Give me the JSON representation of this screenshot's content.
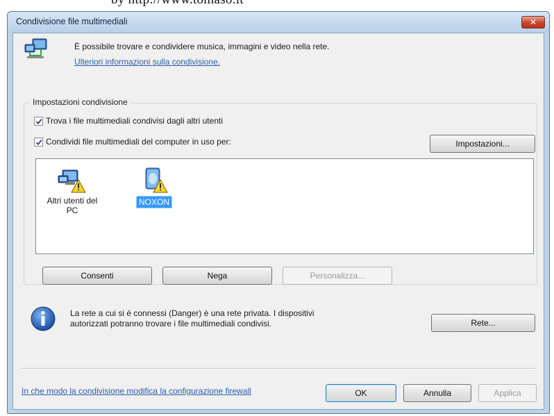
{
  "page_top_text": "by http://www.tomaso.it",
  "window": {
    "title": "Condivisione file multimediali",
    "close_label": "✕"
  },
  "header": {
    "description": "È possibile trovare e condividere musica, immagini e video nella rete.",
    "more_info_link": "Ulteriori informazioni sulla condivisione."
  },
  "sharing_settings": {
    "group_label": "Impostazioni condivisione",
    "find_shared_label": "Trova i file multimediali condivisi dagli altri utenti",
    "find_shared_checked": true,
    "share_media_label": "Condividi file multimediali del computer in uso per:",
    "share_media_checked": true,
    "settings_button": "Impostazioni...",
    "devices": [
      {
        "label": "Altri utenti del PC",
        "selected": false,
        "icon": "pc-users-warning-icon"
      },
      {
        "label": "NOXON",
        "selected": true,
        "icon": "media-device-warning-icon"
      }
    ],
    "allow_button": "Consenti",
    "deny_button": "Nega",
    "customize_button": "Personalizza..."
  },
  "network_info": {
    "text_line1": "La rete a cui si è connessi (Danger) è una rete privata. I dispositivi",
    "text_line2": "autorizzati potranno trovare i file multimediali condivisi.",
    "network_button": "Rete..."
  },
  "footer": {
    "firewall_link": "In che modo la condivisione modifica la configurazione firewall",
    "ok_button": "OK",
    "cancel_button": "Annulla",
    "apply_button": "Applica"
  },
  "colors": {
    "link": "#2a5ea8",
    "selection": "#3399ff",
    "close_button": "#c9442c",
    "title_bar": "#bcd3ea"
  }
}
